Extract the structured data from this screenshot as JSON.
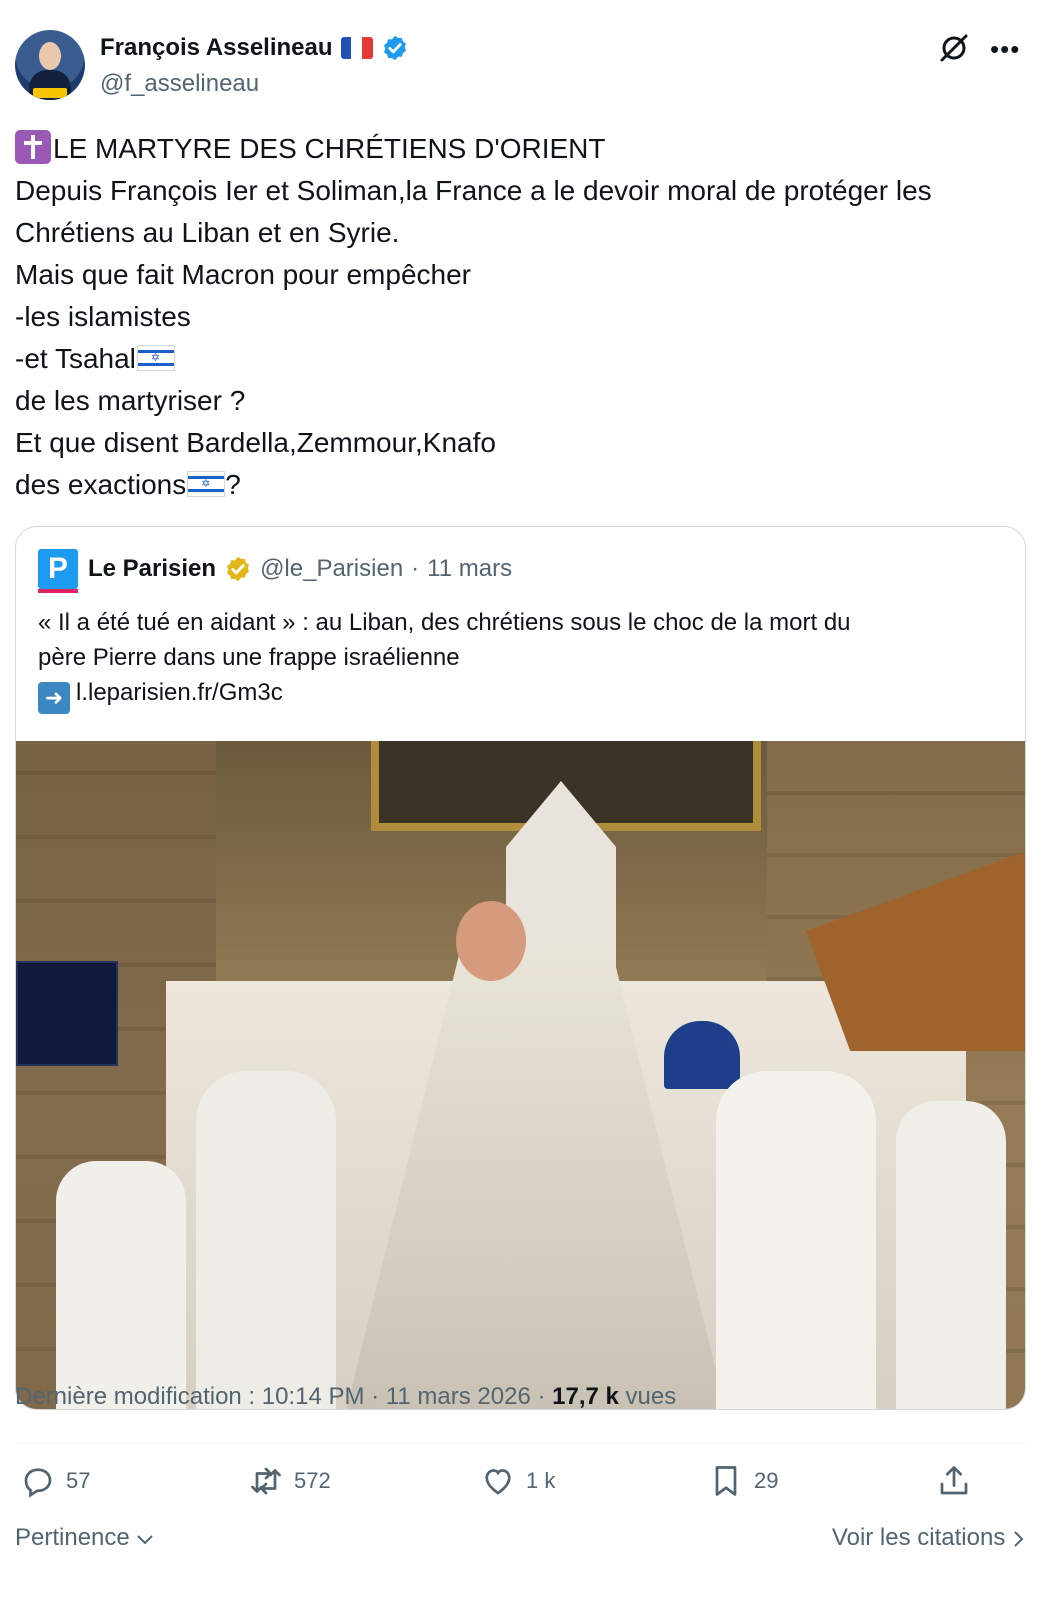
{
  "author": {
    "display_name": "François Asselineau",
    "handle": "@f_asselineau",
    "avatar_badge": "ASSELINEAU 2027"
  },
  "tweet": {
    "lines": [
      "LE MARTYRE DES CHRÉTIENS D'ORIENT",
      "Depuis François Ier et Soliman,la France a le devoir moral de protéger les",
      "Chrétiens au Liban et en Syrie.",
      "Mais que fait Macron pour empêcher",
      "-les islamistes",
      "-et Tsahal",
      "de les martyriser ?",
      "Et que disent Bardella,Zemmour,Knafo",
      "des exactions",
      "?"
    ]
  },
  "quote": {
    "logo_letter": "P",
    "name": "Le Parisien",
    "handle": "@le_Parisien",
    "separator": "·",
    "date": "11 mars",
    "text_lines": [
      "« Il a été tué en aidant » : au Liban, des chrétiens sous le choc de la mort du",
      "père Pierre dans une frappe israélienne"
    ],
    "link": "l.leparisien.fr/Gm3c"
  },
  "meta": {
    "prefix": "Dernière modification : 10:14 PM · 11 mars 2026 · ",
    "views_count": "17,7 k",
    "views_label": " vues"
  },
  "actions": {
    "replies": "57",
    "reposts": "572",
    "likes": "1 k",
    "bookmarks": "29"
  },
  "footer": {
    "sort_label": "Pertinence",
    "quotes_link": "Voir les citations"
  },
  "colors": {
    "text_primary": "#0f1419",
    "text_secondary": "#536471",
    "verified_blue": "#1d9bf0",
    "verified_gold": "#e2b719",
    "border": "#cfd9de"
  }
}
